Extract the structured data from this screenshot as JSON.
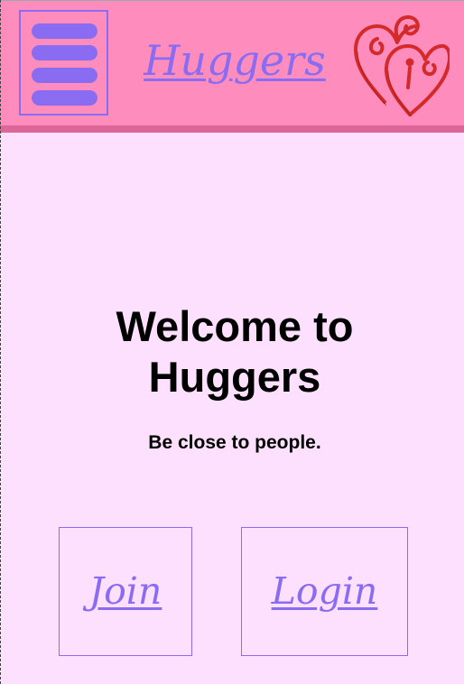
{
  "header": {
    "brand_title": "Huggers",
    "menu_icon": "hamburger-menu-icon",
    "logo_icon": "double-hearts-logo-icon"
  },
  "main": {
    "welcome_title": "Welcome to Huggers",
    "welcome_subtitle": "Be close to people."
  },
  "actions": {
    "join_label": "Join",
    "login_label": "Login"
  },
  "colors": {
    "background": "#fde0fd",
    "header": "#fe8dbe",
    "header_bar": "#dd6699",
    "accent_purple": "#8a6cf2",
    "heart_red": "#d42a2a"
  }
}
